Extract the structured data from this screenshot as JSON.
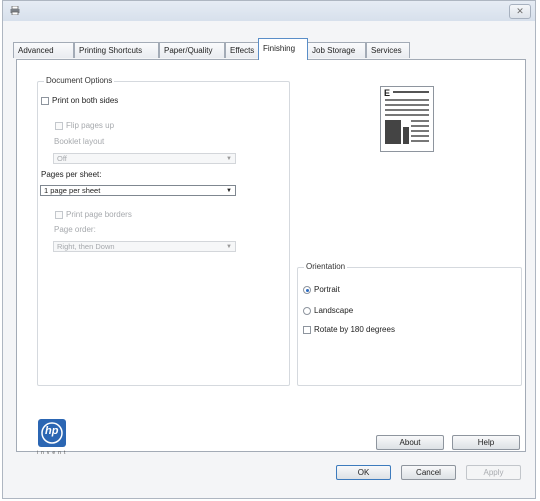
{
  "window": {
    "close_glyph": "✕"
  },
  "tabs": [
    {
      "label": "Advanced",
      "active": false
    },
    {
      "label": "Printing Shortcuts",
      "active": false
    },
    {
      "label": "Paper/Quality",
      "active": false
    },
    {
      "label": "Effects",
      "active": false
    },
    {
      "label": "Finishing",
      "active": true
    },
    {
      "label": "Job Storage",
      "active": false
    },
    {
      "label": "Services",
      "active": false
    }
  ],
  "document_options": {
    "legend": "Document Options",
    "print_both_sides": "Print on both sides",
    "flip_pages_up": "Flip pages up",
    "booklet_layout_label": "Booklet layout",
    "booklet_layout_value": "Off",
    "pages_per_sheet_label": "Pages per sheet:",
    "pages_per_sheet_value": "1 page per sheet",
    "print_page_borders": "Print page borders",
    "page_order_label": "Page order:",
    "page_order_value": "Right, then Down"
  },
  "orientation": {
    "legend": "Orientation",
    "portrait": "Portrait",
    "landscape": "Landscape",
    "rotate_180": "Rotate by 180 degrees",
    "selected": "portrait"
  },
  "buttons": {
    "about": "About",
    "help": "Help",
    "ok": "OK",
    "cancel": "Cancel",
    "apply": "Apply"
  },
  "logo": {
    "mark": "hp",
    "tagline": "invent"
  },
  "preview": {
    "letter": "E"
  }
}
